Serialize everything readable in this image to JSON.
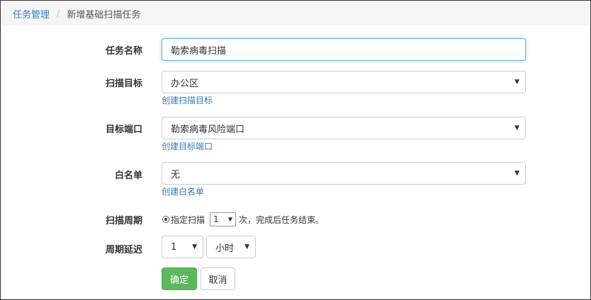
{
  "breadcrumb": {
    "parent": "任务管理",
    "separator": "/",
    "current": "新增基础扫描任务"
  },
  "form": {
    "task_name": {
      "label": "任务名称",
      "value": "勒索病毒扫描"
    },
    "scan_target": {
      "label": "扫描目标",
      "selected": "办公区",
      "create_link": "创建扫描目标"
    },
    "target_port": {
      "label": "目标端口",
      "selected": "勒索病毒风险端口",
      "create_link": "创建目标端口"
    },
    "whitelist": {
      "label": "白名单",
      "selected": "无",
      "create_link": "创建白名单"
    },
    "scan_cycle": {
      "label": "扫描周期",
      "option_prefix": "指定扫描",
      "count_selected": "1",
      "option_suffix": "次，完成后任务结束。"
    },
    "cycle_delay": {
      "label": "周期延迟",
      "amount_selected": "1",
      "unit_selected": "小时"
    }
  },
  "actions": {
    "confirm": "确定",
    "cancel": "取消"
  },
  "icons": {
    "dropdown": "▼"
  },
  "colors": {
    "link": "#337ab7",
    "primary": "#5cb85c",
    "focus": "#66afe9"
  }
}
